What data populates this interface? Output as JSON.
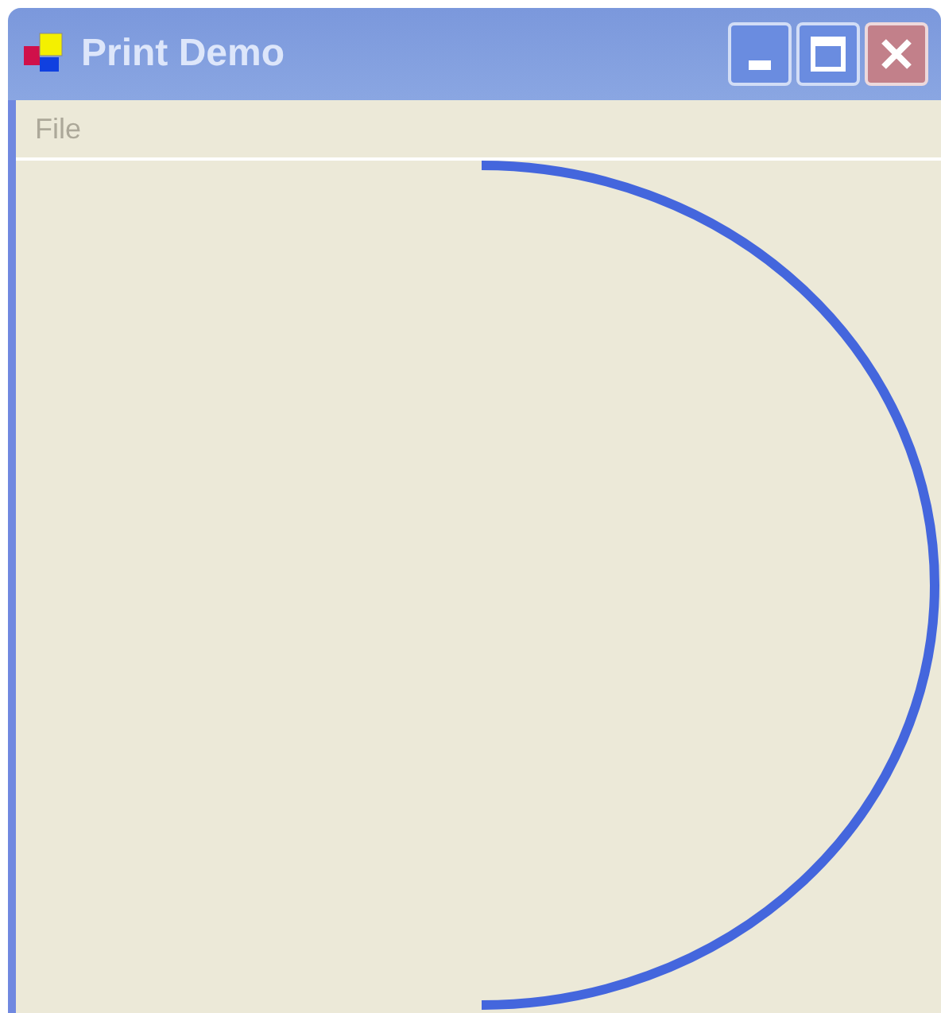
{
  "window": {
    "title": "Print Demo",
    "active": false
  },
  "menu": [
    {
      "label": "File",
      "disabled": true
    }
  ]
}
